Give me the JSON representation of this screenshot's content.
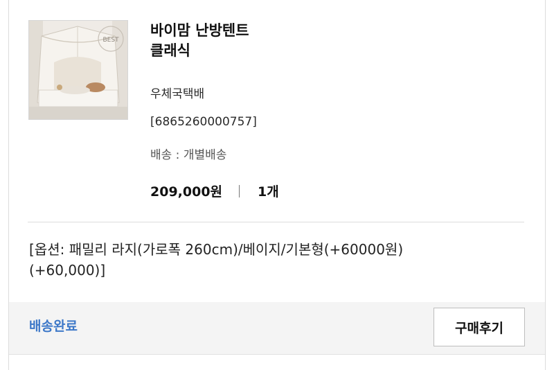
{
  "product": {
    "title_line1": "바이맘 난방텐트",
    "title_line2": "클래식",
    "badge": "BEST",
    "courier": "우체국택배",
    "tracking_number": "[6865260000757]",
    "shipping_label": "배송 : 개별배송",
    "price": "209,000원",
    "quantity": "1개"
  },
  "option": {
    "line1": "[옵션: 패밀리 라지(가로폭 260cm)/베이지/기본형(+60000원)",
    "line2": "(+60,000)]"
  },
  "footer": {
    "status": "배송완료",
    "review_button": "구매후기"
  },
  "colors": {
    "status": "#3d78c8",
    "footer_bg": "#f4f4f4"
  }
}
